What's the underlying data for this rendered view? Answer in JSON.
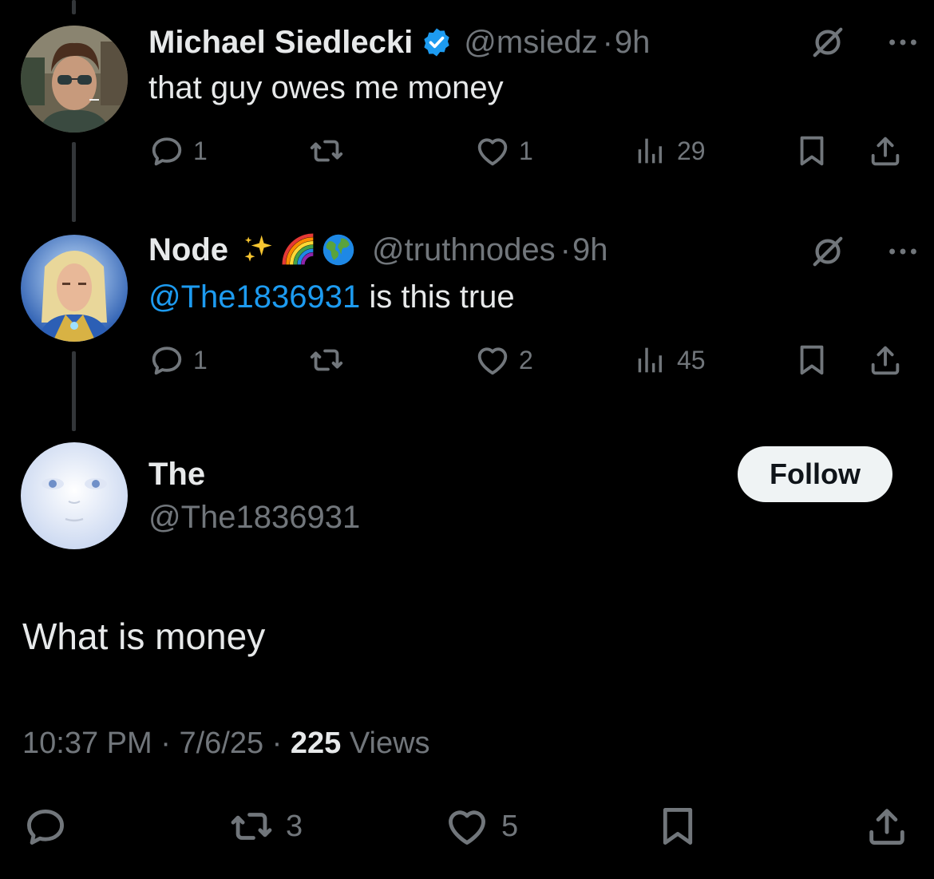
{
  "tweets": [
    {
      "name": "Michael Siedlecki",
      "verified": true,
      "handle": "@msiedz",
      "time": "9h",
      "text": "that guy owes me money",
      "counts": {
        "replies": "1",
        "retweets": "",
        "likes": "1",
        "views": "29"
      }
    },
    {
      "name": "Node",
      "emojis": [
        "sparkles-emoji",
        "rainbow-emoji",
        "globe-emoji"
      ],
      "handle": "@truthnodes",
      "time": "9h",
      "mention": "@The1836931",
      "text": " is this true",
      "counts": {
        "replies": "1",
        "retweets": "",
        "likes": "2",
        "views": "45"
      }
    }
  ],
  "main": {
    "name": "The",
    "handle": "@The1836931",
    "follow_label": "Follow",
    "text": "What is money",
    "time": "10:37 PM",
    "date": "7/6/25",
    "views_count": "225",
    "views_label": "Views",
    "counts": {
      "replies": "",
      "retweets": "3",
      "likes": "5"
    }
  },
  "colors": {
    "background": "#000000",
    "text": "#e7e9ea",
    "secondary": "#71767b",
    "link": "#1d9bf0",
    "verified": "#1d9bf0",
    "follow_button": "#eff3f4"
  },
  "icons": [
    "reply-icon",
    "retweet-icon",
    "like-icon",
    "views-icon",
    "bookmark-icon",
    "share-icon",
    "grok-icon",
    "more-icon",
    "verified-badge-icon"
  ]
}
